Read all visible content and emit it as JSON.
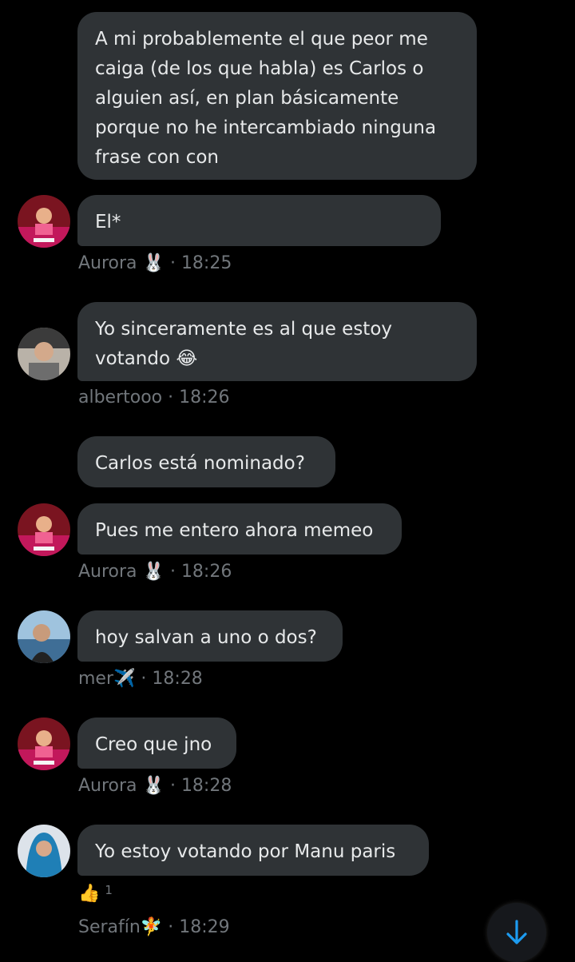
{
  "messages": [
    {
      "text": "A mi probablemente el que peor me caiga (de los que habla) es Carlos o alguien así, en plan básicamente porque no he intercambiado ninguna frase con con"
    },
    {
      "text": "El*"
    },
    {
      "text": "Yo sinceramente es al que estoy votando 😂"
    },
    {
      "text": "Carlos está nominado?"
    },
    {
      "text": "Pues me entero ahora memeo"
    },
    {
      "text": "hoy salvan a uno o dos?"
    },
    {
      "text": "Creo que jno"
    },
    {
      "text": "Yo estoy votando por Manu paris"
    }
  ],
  "meta": [
    {
      "name": "Aurora",
      "emoji": "🐰",
      "time": "· 18:25"
    },
    {
      "name": "albertooo",
      "emoji": "",
      "time": "· 18:26"
    },
    {
      "name": "Aurora",
      "emoji": "🐰",
      "time": "· 18:26"
    },
    {
      "name": "mer",
      "emoji": "✈️",
      "time": "· 18:28"
    },
    {
      "name": "Aurora",
      "emoji": "🐰",
      "time": "· 18:28"
    },
    {
      "name": "Serafín",
      "emoji": "🧚",
      "time": "· 18:29"
    }
  ],
  "reaction": {
    "emoji": "👍",
    "count": "1"
  },
  "colors": {
    "background": "#000000",
    "bubble": "#2f3336",
    "meta": "#71767b",
    "accent": "#1d9bf0"
  },
  "icons": {
    "scroll_down": "arrow-down-icon"
  }
}
